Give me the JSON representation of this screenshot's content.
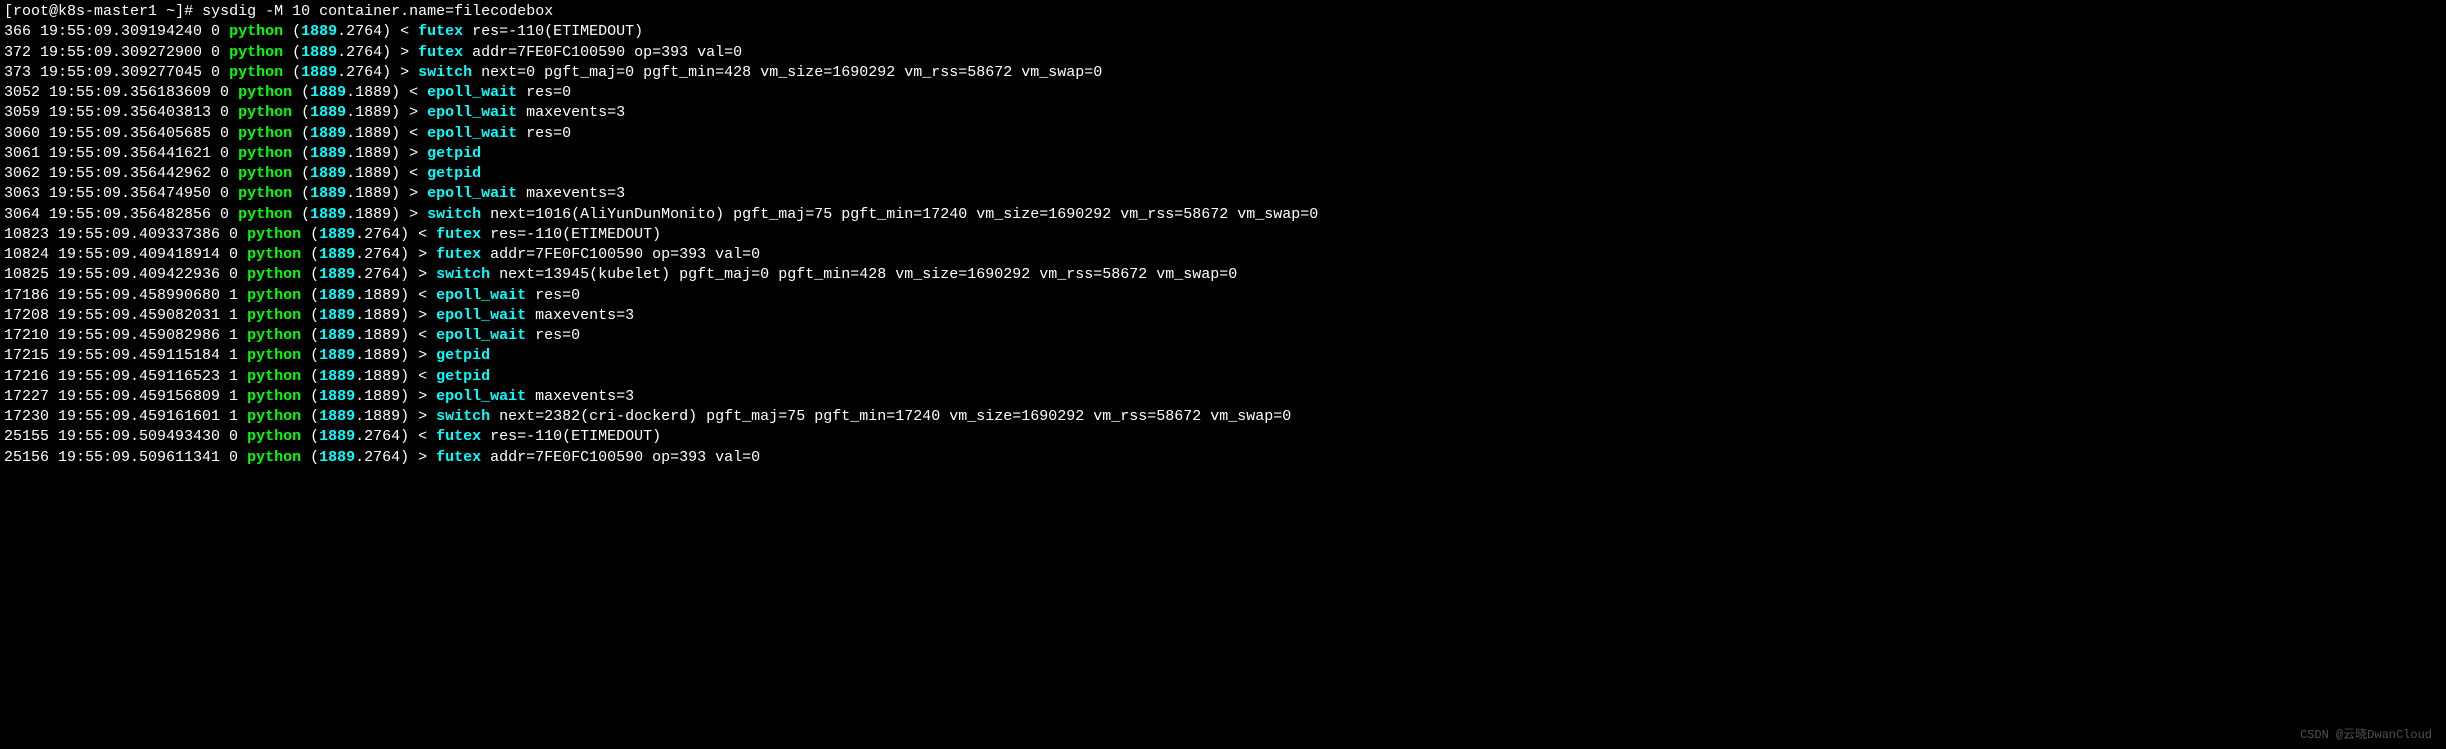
{
  "prompt": {
    "open_bracket": "[",
    "user": "root",
    "at": "@",
    "host": "k8s-master1",
    "space": " ",
    "dir": "~",
    "close_bracket": "]",
    "hash": "# "
  },
  "command": "sysdig -M 10 container.name=filecodebox",
  "lines": [
    {
      "evt": "366",
      "ts": "19:55:09.309194240",
      "cpu": "0",
      "proc": "python",
      "pid": "1889",
      "tid": "2764",
      "dir": "<",
      "syscall": "futex",
      "args": "res=-110(ETIMEDOUT)"
    },
    {
      "evt": "372",
      "ts": "19:55:09.309272900",
      "cpu": "0",
      "proc": "python",
      "pid": "1889",
      "tid": "2764",
      "dir": ">",
      "syscall": "futex",
      "args": "addr=7FE0FC100590 op=393 val=0"
    },
    {
      "evt": "373",
      "ts": "19:55:09.309277045",
      "cpu": "0",
      "proc": "python",
      "pid": "1889",
      "tid": "2764",
      "dir": ">",
      "syscall": "switch",
      "args": "next=0 pgft_maj=0 pgft_min=428 vm_size=1690292 vm_rss=58672 vm_swap=0"
    },
    {
      "evt": "3052",
      "ts": "19:55:09.356183609",
      "cpu": "0",
      "proc": "python",
      "pid": "1889",
      "tid": "1889",
      "dir": "<",
      "syscall": "epoll_wait",
      "args": "res=0"
    },
    {
      "evt": "3059",
      "ts": "19:55:09.356403813",
      "cpu": "0",
      "proc": "python",
      "pid": "1889",
      "tid": "1889",
      "dir": ">",
      "syscall": "epoll_wait",
      "args": "maxevents=3"
    },
    {
      "evt": "3060",
      "ts": "19:55:09.356405685",
      "cpu": "0",
      "proc": "python",
      "pid": "1889",
      "tid": "1889",
      "dir": "<",
      "syscall": "epoll_wait",
      "args": "res=0"
    },
    {
      "evt": "3061",
      "ts": "19:55:09.356441621",
      "cpu": "0",
      "proc": "python",
      "pid": "1889",
      "tid": "1889",
      "dir": ">",
      "syscall": "getpid",
      "args": ""
    },
    {
      "evt": "3062",
      "ts": "19:55:09.356442962",
      "cpu": "0",
      "proc": "python",
      "pid": "1889",
      "tid": "1889",
      "dir": "<",
      "syscall": "getpid",
      "args": ""
    },
    {
      "evt": "3063",
      "ts": "19:55:09.356474950",
      "cpu": "0",
      "proc": "python",
      "pid": "1889",
      "tid": "1889",
      "dir": ">",
      "syscall": "epoll_wait",
      "args": "maxevents=3"
    },
    {
      "evt": "3064",
      "ts": "19:55:09.356482856",
      "cpu": "0",
      "proc": "python",
      "pid": "1889",
      "tid": "1889",
      "dir": ">",
      "syscall": "switch",
      "args": "next=1016(AliYunDunMonito) pgft_maj=75 pgft_min=17240 vm_size=1690292 vm_rss=58672 vm_swap=0"
    },
    {
      "evt": "10823",
      "ts": "19:55:09.409337386",
      "cpu": "0",
      "proc": "python",
      "pid": "1889",
      "tid": "2764",
      "dir": "<",
      "syscall": "futex",
      "args": "res=-110(ETIMEDOUT)"
    },
    {
      "evt": "10824",
      "ts": "19:55:09.409418914",
      "cpu": "0",
      "proc": "python",
      "pid": "1889",
      "tid": "2764",
      "dir": ">",
      "syscall": "futex",
      "args": "addr=7FE0FC100590 op=393 val=0"
    },
    {
      "evt": "10825",
      "ts": "19:55:09.409422936",
      "cpu": "0",
      "proc": "python",
      "pid": "1889",
      "tid": "2764",
      "dir": ">",
      "syscall": "switch",
      "args": "next=13945(kubelet) pgft_maj=0 pgft_min=428 vm_size=1690292 vm_rss=58672 vm_swap=0"
    },
    {
      "evt": "17186",
      "ts": "19:55:09.458990680",
      "cpu": "1",
      "proc": "python",
      "pid": "1889",
      "tid": "1889",
      "dir": "<",
      "syscall": "epoll_wait",
      "args": "res=0"
    },
    {
      "evt": "17208",
      "ts": "19:55:09.459082031",
      "cpu": "1",
      "proc": "python",
      "pid": "1889",
      "tid": "1889",
      "dir": ">",
      "syscall": "epoll_wait",
      "args": "maxevents=3"
    },
    {
      "evt": "17210",
      "ts": "19:55:09.459082986",
      "cpu": "1",
      "proc": "python",
      "pid": "1889",
      "tid": "1889",
      "dir": "<",
      "syscall": "epoll_wait",
      "args": "res=0"
    },
    {
      "evt": "17215",
      "ts": "19:55:09.459115184",
      "cpu": "1",
      "proc": "python",
      "pid": "1889",
      "tid": "1889",
      "dir": ">",
      "syscall": "getpid",
      "args": ""
    },
    {
      "evt": "17216",
      "ts": "19:55:09.459116523",
      "cpu": "1",
      "proc": "python",
      "pid": "1889",
      "tid": "1889",
      "dir": "<",
      "syscall": "getpid",
      "args": ""
    },
    {
      "evt": "17227",
      "ts": "19:55:09.459156809",
      "cpu": "1",
      "proc": "python",
      "pid": "1889",
      "tid": "1889",
      "dir": ">",
      "syscall": "epoll_wait",
      "args": "maxevents=3"
    },
    {
      "evt": "17230",
      "ts": "19:55:09.459161601",
      "cpu": "1",
      "proc": "python",
      "pid": "1889",
      "tid": "1889",
      "dir": ">",
      "syscall": "switch",
      "args": "next=2382(cri-dockerd) pgft_maj=75 pgft_min=17240 vm_size=1690292 vm_rss=58672 vm_swap=0"
    },
    {
      "evt": "25155",
      "ts": "19:55:09.509493430",
      "cpu": "0",
      "proc": "python",
      "pid": "1889",
      "tid": "2764",
      "dir": "<",
      "syscall": "futex",
      "args": "res=-110(ETIMEDOUT)"
    },
    {
      "evt": "25156",
      "ts": "19:55:09.509611341",
      "cpu": "0",
      "proc": "python",
      "pid": "1889",
      "tid": "2764",
      "dir": ">",
      "syscall": "futex",
      "args": "addr=7FE0FC100590 op=393 val=0"
    }
  ],
  "watermark": "CSDN @云晓DwanCloud"
}
